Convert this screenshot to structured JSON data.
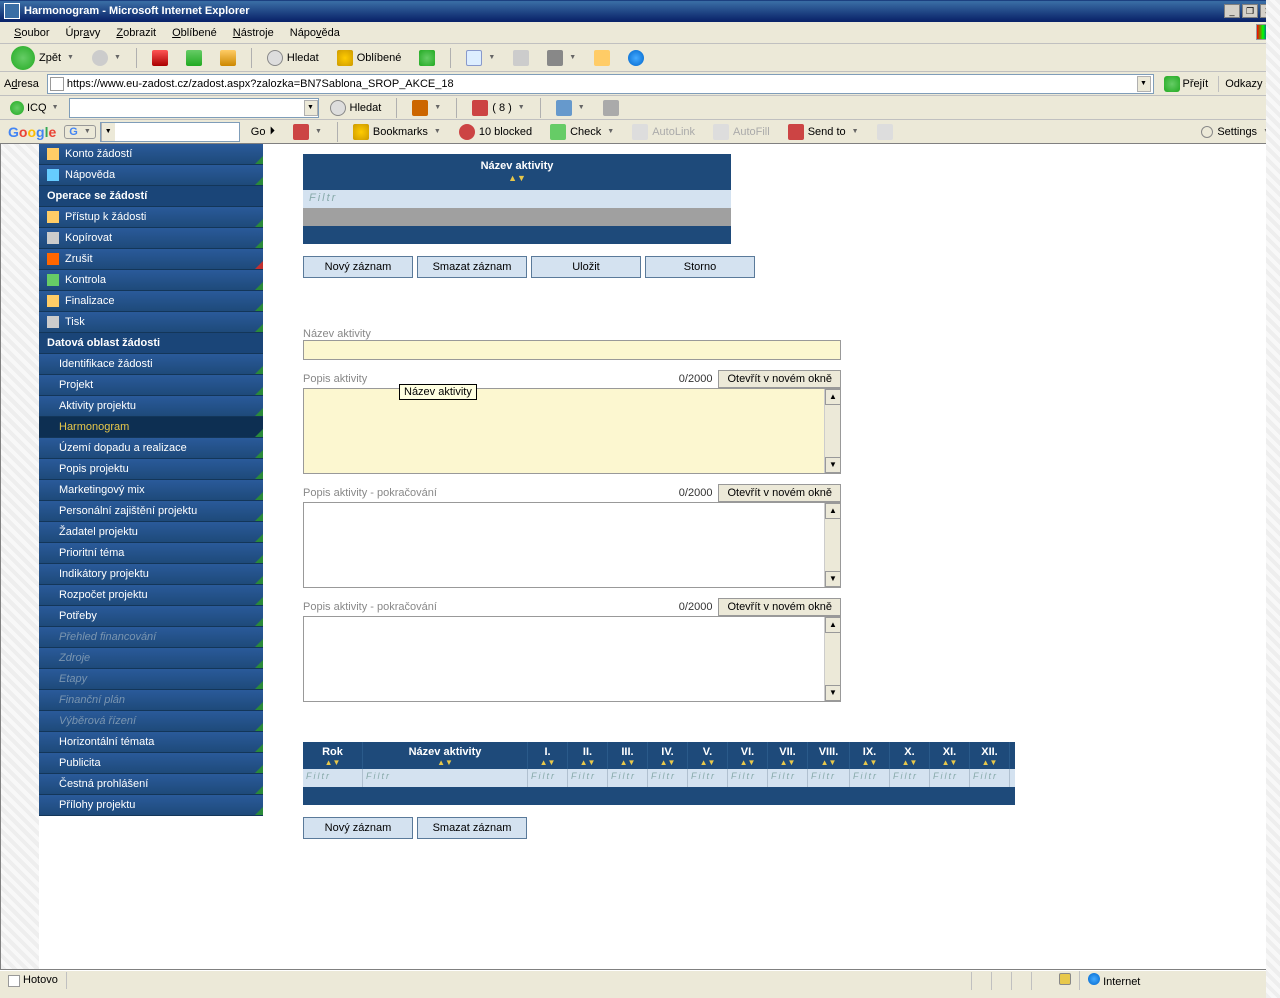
{
  "window": {
    "title": "Harmonogram - Microsoft Internet Explorer"
  },
  "menu": {
    "items": [
      "Soubor",
      "Úpravy",
      "Zobrazit",
      "Oblíbené",
      "Nástroje",
      "Nápověda"
    ]
  },
  "toolbar": {
    "back": "Zpět",
    "search": "Hledat",
    "favorites": "Oblíbené"
  },
  "address": {
    "label": "Adresa",
    "url": "https://www.eu-zadost.cz/zadost.aspx?zalozka=BN7Sablona_SROP_AKCE_18",
    "go": "Přejít",
    "links": "Odkazy"
  },
  "icq": {
    "label": "ICQ",
    "search": "Hledat",
    "count": "( 8 )"
  },
  "google": {
    "go": "Go",
    "bookmarks": "Bookmarks",
    "blocked": "10 blocked",
    "check": "Check",
    "autolink": "AutoLink",
    "autofill": "AutoFill",
    "sendto": "Send to",
    "settings": "Settings"
  },
  "sidebar": {
    "group1": [
      {
        "label": "Konto žádostí",
        "icon": "konto"
      },
      {
        "label": "Nápověda",
        "icon": "help"
      }
    ],
    "header2": "Operace se žádostí",
    "group2": [
      {
        "label": "Přístup k žádosti",
        "icon": "access"
      },
      {
        "label": "Kopírovat",
        "icon": "copy"
      },
      {
        "label": "Zrušit",
        "icon": "cancel",
        "corner": "red"
      },
      {
        "label": "Kontrola",
        "icon": "check"
      },
      {
        "label": "Finalizace",
        "icon": "lock"
      },
      {
        "label": "Tisk",
        "icon": "print"
      }
    ],
    "header3": "Datová oblast žádosti",
    "group3": [
      {
        "label": "Identifikace žádosti"
      },
      {
        "label": "Projekt"
      },
      {
        "label": "Aktivity projektu"
      },
      {
        "label": "Harmonogram",
        "active": true
      },
      {
        "label": "Území dopadu a realizace"
      },
      {
        "label": "Popis projektu"
      },
      {
        "label": "Marketingový mix"
      },
      {
        "label": "Personální zajištění projektu"
      },
      {
        "label": "Žadatel projektu"
      },
      {
        "label": "Prioritní téma"
      },
      {
        "label": "Indikátory projektu"
      },
      {
        "label": "Rozpočet projektu"
      },
      {
        "label": "Potřeby"
      },
      {
        "label": "Přehled financování",
        "disabled": true
      },
      {
        "label": "Zdroje",
        "disabled": true
      },
      {
        "label": "Etapy",
        "disabled": true
      },
      {
        "label": "Finanční plán",
        "disabled": true
      },
      {
        "label": "Výběrová řízení",
        "disabled": true
      },
      {
        "label": "Horizontální témata"
      },
      {
        "label": "Publicita"
      },
      {
        "label": "Čestná prohlášení"
      },
      {
        "label": "Přílohy projektu"
      }
    ]
  },
  "main": {
    "table_header": "Název aktivity",
    "filter_placeholder": "Filtr",
    "buttons": {
      "new": "Nový záznam",
      "delete": "Smazat záznam",
      "save": "Uložit",
      "cancel": "Storno"
    },
    "field_nazev": "Název aktivity",
    "field_popis": "Popis aktivity",
    "field_popis2": "Popis aktivity - pokračování",
    "field_popis3": "Popis aktivity - pokračování",
    "counter1": "0/2000",
    "counter2": "0/2000",
    "counter3": "0/2000",
    "open_window": "Otevřít v novém okně",
    "tooltip": "Název aktivity",
    "schedule": {
      "cols": [
        "Rok",
        "Název aktivity",
        "I.",
        "II.",
        "III.",
        "IV.",
        "V.",
        "VI.",
        "VII.",
        "VIII.",
        "IX.",
        "X.",
        "XI.",
        "XII."
      ]
    }
  },
  "status": {
    "done": "Hotovo",
    "zone": "Internet"
  }
}
